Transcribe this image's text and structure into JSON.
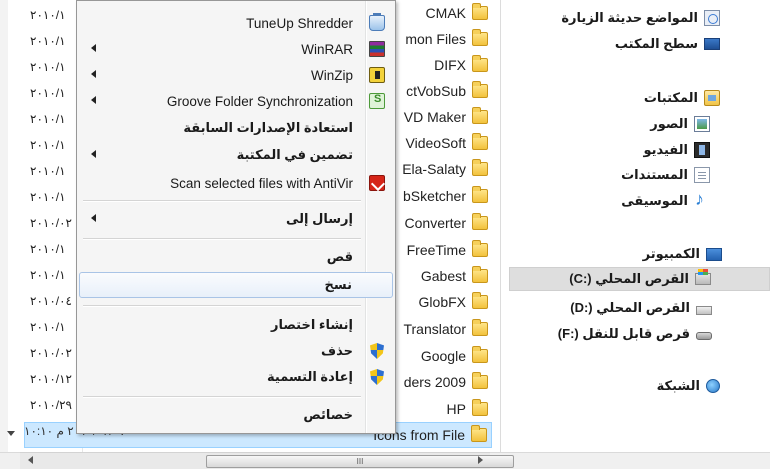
{
  "dates": [
    "٢٠١٠/١",
    "٢٠١٠/١",
    "٢٠١٠/١",
    "٢٠١٠/١",
    "٢٠١٠/١",
    "٢٠١٠/١",
    "٢٠١٠/١",
    "٢٠١٠/١",
    "٢٠١٠/٠٢",
    "٢٠١٠/١",
    "٢٠١٠/١",
    "٢٠١٠/٠٤",
    "٢٠١٠/١",
    "٢٠١٠/٠٢",
    "٢٠١٠/١٢",
    "٢٠١٠/٢٩"
  ],
  "hidden_row_date": "٢٠١٠/٠٢/٠٧ م ١٠:١٠",
  "folders": [
    "CMAK",
    "mon Files",
    "DIFX",
    "ctVobSub",
    "VD Maker",
    "VideoSoft",
    "Ela-Salaty",
    "bSketcher",
    "Converter",
    "FreeTime",
    "Gabest",
    "GlobFX",
    "Translator",
    "Google",
    "ders 2009",
    "HP",
    "Icons from File"
  ],
  "nav": {
    "recent": "المواضع حديثة الزيارة",
    "desktop": "سطح المكتب",
    "libraries": "المكتبات",
    "pictures": "الصور",
    "videos": "الفيديو",
    "documents": "المستندات",
    "music": "الموسيقى",
    "computer": "الكمبيوتر",
    "drive_c": "القرص المحلي (:C)",
    "drive_d": "القرص المحلي (:D)",
    "removable": "قرص قابل للنقل (:F)",
    "network": "الشبكة"
  },
  "menu": {
    "tuneup": "TuneUp Shredder",
    "winrar": "WinRAR",
    "winzip": "WinZip",
    "groove": "Groove Folder Synchronization",
    "restore": "استعادة الإصدارات السابقة",
    "include_library": "تضمين في المكتبة",
    "antivir": "Scan selected files with AntiVir",
    "send_to": "إرسال إلى",
    "cut": "قص",
    "copy": "نسخ",
    "create_shortcut": "إنشاء اختصار",
    "delete": "حذف",
    "rename": "إعادة التسمية",
    "properties": "خصائص"
  },
  "scrollbar_grip": "III"
}
